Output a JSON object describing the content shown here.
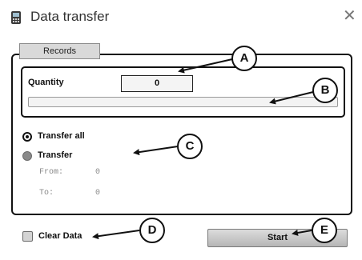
{
  "window": {
    "title": "Data transfer",
    "close_glyph": "✕",
    "icon": "data-transfer-device-icon"
  },
  "group": {
    "tab_label": "Records"
  },
  "quantity": {
    "label": "Quantity",
    "value": "0",
    "progress_fraction": 0
  },
  "options": {
    "transfer_all_label": "Transfer all",
    "transfer_label": "Transfer",
    "selected": "Transfer all",
    "from_label": "From:",
    "from_value": "0",
    "to_label": "To:",
    "to_value": "0"
  },
  "footer": {
    "clear_data_label": "Clear Data",
    "clear_data_checked": false,
    "start_label": "Start"
  },
  "callouts": {
    "a": "A",
    "b": "B",
    "c": "C",
    "d": "D",
    "e": "E"
  }
}
